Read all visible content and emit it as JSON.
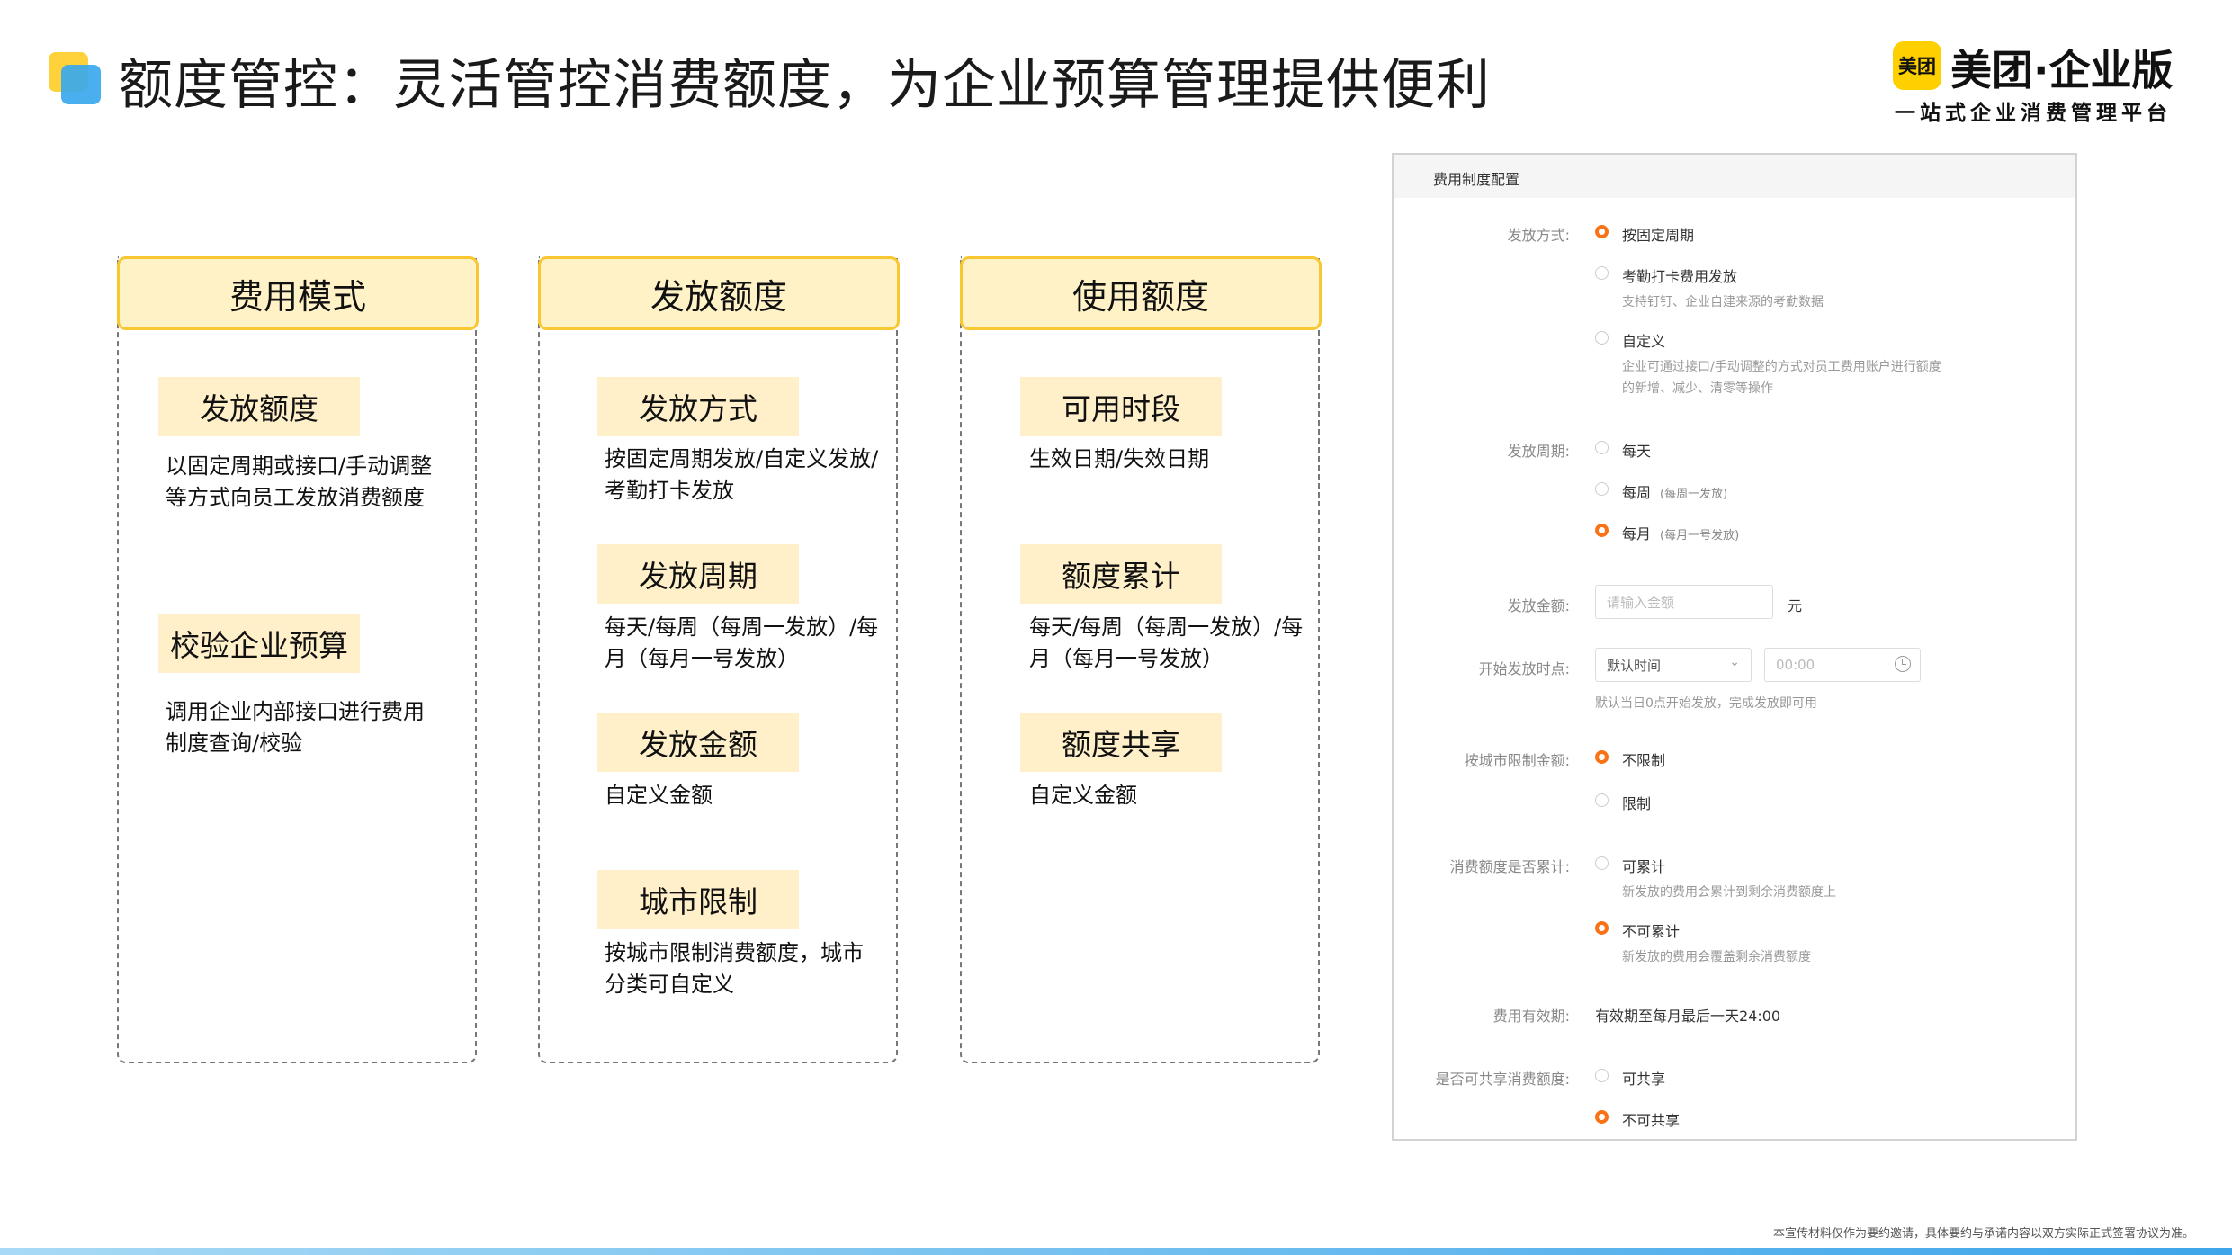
{
  "header": {
    "title": "额度管控：灵活管控消费额度，为企业预算管理提供便利",
    "brand_logo": "美团",
    "brand_name": "美团·企业版",
    "brand_tagline": "一站式企业消费管理平台"
  },
  "columns": [
    {
      "title": "费用模式",
      "items": [
        {
          "tag": "发放额度",
          "desc": "以固定周期或接口/手动调整等方式向员工发放消费额度"
        },
        {
          "tag": "校验企业预算",
          "desc": "调用企业内部接口进行费用制度查询/校验"
        }
      ]
    },
    {
      "title": "发放额度",
      "items": [
        {
          "tag": "发放方式",
          "desc": "按固定周期发放/自定义发放/考勤打卡发放"
        },
        {
          "tag": "发放周期",
          "desc": "每天/每周（每周一发放）/每月（每月一号发放）"
        },
        {
          "tag": "发放金额",
          "desc": "自定义金额"
        },
        {
          "tag": "城市限制",
          "desc": "按城市限制消费额度，城市分类可自定义"
        }
      ]
    },
    {
      "title": "使用额度",
      "items": [
        {
          "tag": "可用时段",
          "desc": "生效日期/失效日期"
        },
        {
          "tag": "额度累计",
          "desc": "每天/每周（每周一发放）/每月（每月一号发放）"
        },
        {
          "tag": "额度共享",
          "desc": "自定义金额"
        }
      ]
    }
  ],
  "config": {
    "title": "费用制度配置",
    "method": {
      "label": "发放方式:",
      "options": [
        {
          "label": "按固定周期",
          "checked": true
        },
        {
          "label": "考勤打卡费用发放",
          "hint": "支持钉钉、企业自建来源的考勤数据",
          "checked": false
        },
        {
          "label": "自定义",
          "hint": "企业可通过接口/手动调整的方式对员工费用账户进行额度的新增、减少、清零等操作",
          "hint_line1": "企业可通过接口/手动调整的方式对员工费用账户进行额度",
          "hint_line2": "的新增、减少、清零等操作",
          "checked": false
        }
      ]
    },
    "cycle": {
      "label": "发放周期:",
      "options": [
        {
          "label": "每天",
          "note": "",
          "checked": false
        },
        {
          "label": "每周",
          "note": "(每周一发放)",
          "checked": false
        },
        {
          "label": "每月",
          "note": "(每月一号发放)",
          "checked": true
        }
      ]
    },
    "amount": {
      "label": "发放金额:",
      "placeholder": "请输入金额",
      "unit": "元"
    },
    "start": {
      "label": "开始发放时点:",
      "select_value": "默认时间",
      "time_placeholder": "00:00",
      "hint": "默认当日0点开始发放，完成发放即可用"
    },
    "city": {
      "label": "按城市限制金额:",
      "options": [
        {
          "label": "不限制",
          "checked": true
        },
        {
          "label": "限制",
          "checked": false
        }
      ]
    },
    "accumulate": {
      "label": "消费额度是否累计:",
      "options": [
        {
          "label": "可累计",
          "hint": "新发放的费用会累计到剩余消费额度上",
          "checked": false
        },
        {
          "label": "不可累计",
          "hint": "新发放的费用会覆盖剩余消费额度",
          "checked": true
        }
      ]
    },
    "validity": {
      "label": "费用有效期:",
      "value": "有效期至每月最后一天24:00"
    },
    "share": {
      "label": "是否可共享消费额度:",
      "options": [
        {
          "label": "可共享",
          "checked": false
        },
        {
          "label": "不可共享",
          "checked": true
        }
      ]
    }
  },
  "footer": {
    "disclaimer": "本宣传材料仅作为要约邀请，具体要约与承诺内容以双方实际正式签署协议为准。"
  },
  "colors": {
    "accent_yellow": "#f8c832",
    "tag_bg": "#fff0c9",
    "radio_orange": "#f97316",
    "bar_blue": "#3ea5ea"
  }
}
